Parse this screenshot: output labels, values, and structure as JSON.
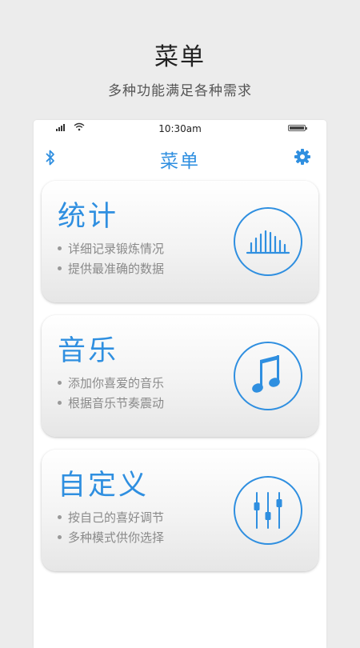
{
  "promo": {
    "title": "菜单",
    "subtitle": "多种功能满足各种需求"
  },
  "status_bar": {
    "time": "10:30am",
    "icons": [
      "signal-icon",
      "wifi-icon",
      "battery-icon"
    ]
  },
  "nav": {
    "title": "菜单",
    "left_icon": "bluetooth-icon",
    "right_icon": "gear-icon"
  },
  "colors": {
    "accent": "#2f8fe0",
    "background": "#ececec",
    "secondary_text": "#8a8a8a"
  },
  "cards": [
    {
      "title": "统计",
      "lines": [
        "详细记录锻炼情况",
        "提供最准确的数据"
      ],
      "icon": "bar-chart-icon"
    },
    {
      "title": "音乐",
      "lines": [
        "添加你喜爱的音乐",
        "根据音乐节奏震动"
      ],
      "icon": "music-note-icon"
    },
    {
      "title": "自定义",
      "lines": [
        "按自己的喜好调节",
        "多种模式供你选择"
      ],
      "icon": "equalizer-icon"
    }
  ]
}
